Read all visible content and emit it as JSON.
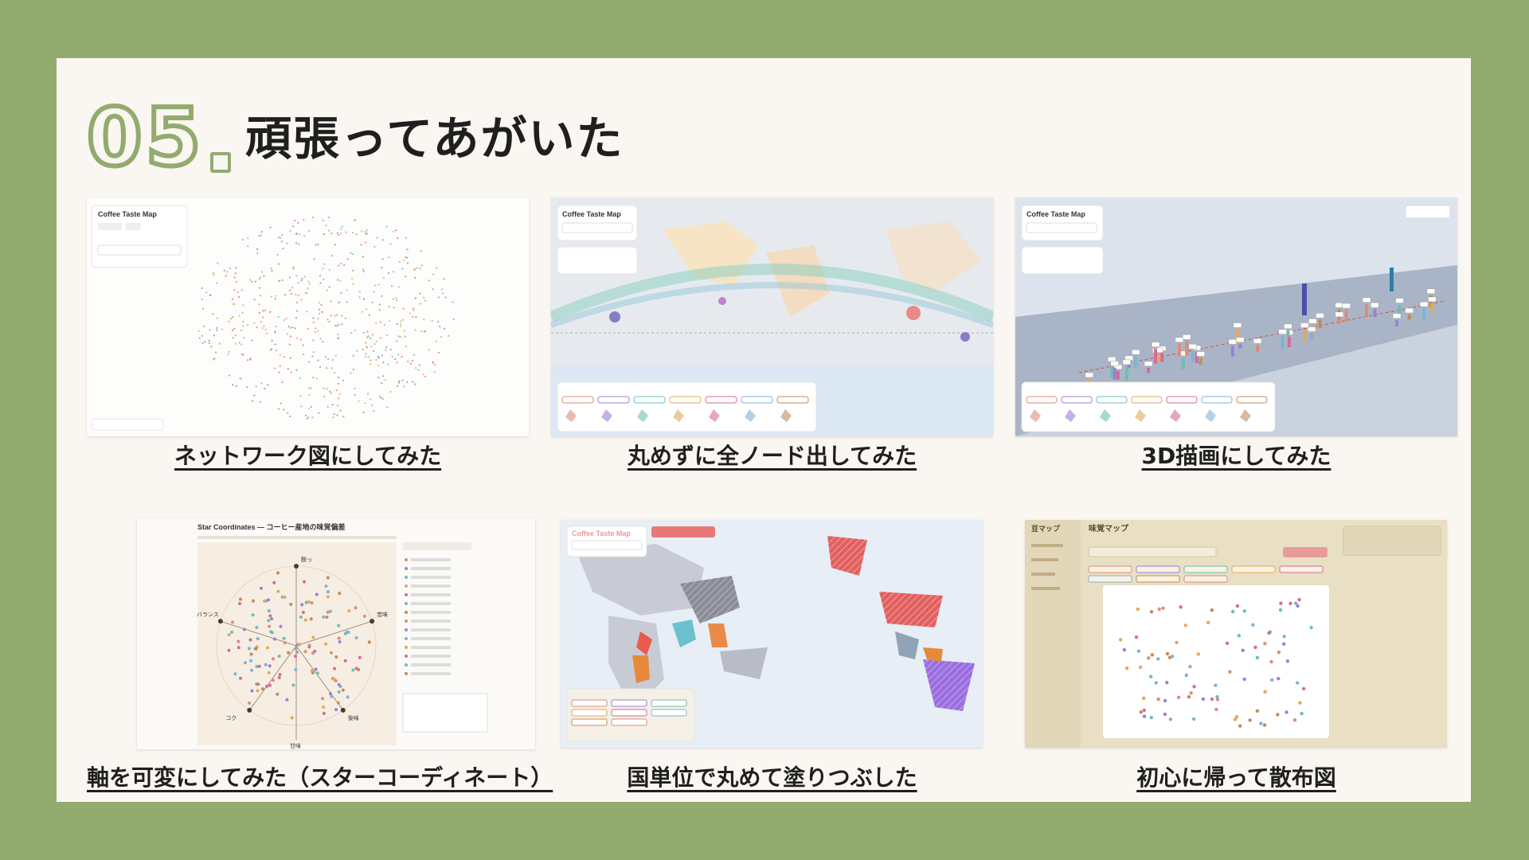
{
  "heading": {
    "number": "05",
    "title": "頑張ってあがいた"
  },
  "app_name": "Coffee Taste Map",
  "colors": {
    "background": "#92ab6e",
    "card": "#faf6f1",
    "accent": "#92ab6e"
  },
  "items": [
    {
      "caption": "ネットワーク図にしてみた",
      "shot_name": "network-graph-screenshot"
    },
    {
      "caption": "丸めずに全ノード出してみた",
      "shot_name": "world-map-all-nodes-screenshot"
    },
    {
      "caption": "3D描画にしてみた",
      "shot_name": "3d-render-screenshot"
    },
    {
      "caption": "軸を可変にしてみた（スターコーディネート）",
      "shot_name": "star-coordinates-screenshot"
    },
    {
      "caption": "国単位で丸めて塗りつぶした",
      "shot_name": "country-fill-map-screenshot"
    },
    {
      "caption": "初心に帰って散布図",
      "shot_name": "scatter-plot-screenshot"
    }
  ],
  "star": {
    "title": "Star Coordinates — コーヒー産地の味覚偏差",
    "axes": [
      "酸っ",
      "苦味",
      "後味",
      "コク",
      "バランス"
    ],
    "bottom_axis": "甘味"
  },
  "scatter": {
    "app_title": "豆マップ",
    "heading": "味覚マップ"
  }
}
